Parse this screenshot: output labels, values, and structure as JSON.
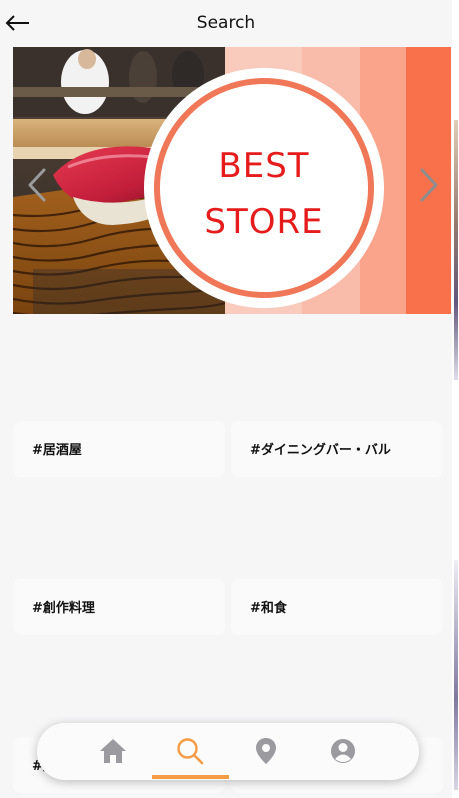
{
  "header": {
    "title": "Search"
  },
  "banner": {
    "badge_line1": "BEST",
    "badge_line2": "STORE",
    "stripe_colors": [
      "#f9cbbd",
      "#f9bcaa",
      "#fba48c",
      "#f9714b"
    ],
    "badge_ring_color": "#f07757",
    "badge_text_color": "#e61c1c"
  },
  "tags": [
    {
      "label": "#居酒屋"
    },
    {
      "label": "#ダイニングバー・バル"
    },
    {
      "label": "#創作料理"
    },
    {
      "label": "#和食"
    },
    {
      "label": "#焼"
    },
    {
      "label": ""
    }
  ],
  "bottom_nav": {
    "items": [
      {
        "icon": "home-icon"
      },
      {
        "icon": "search-icon",
        "active": true
      },
      {
        "icon": "location-pin-icon"
      },
      {
        "icon": "user-icon"
      }
    ],
    "active_color": "#f59a45",
    "inactive_color": "#9a9a9f"
  }
}
